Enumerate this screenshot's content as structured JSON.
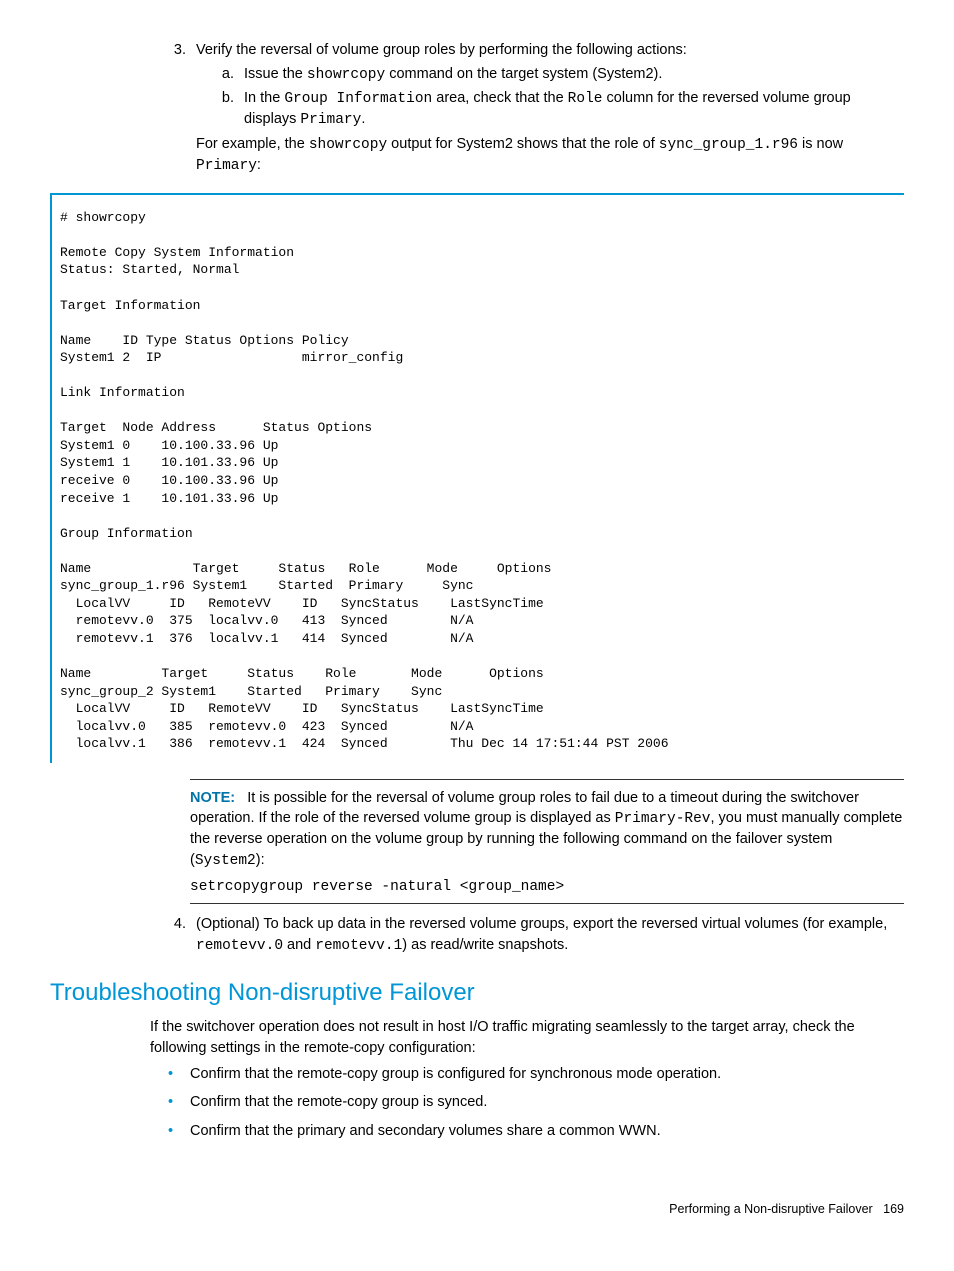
{
  "steps": {
    "s3": {
      "intro": "Verify the reversal of volume group roles by performing the following actions:",
      "a_pre": "Issue the ",
      "a_cmd": "showrcopy",
      "a_post": " command on the target system (System2).",
      "b_pre": "In the ",
      "b_code1": "Group Information",
      "b_mid1": " area, check that the ",
      "b_code2": "Role",
      "b_mid2": " column for the reversed volume group displays ",
      "b_code3": "Primary",
      "b_end": ".",
      "eg_pre": "For example, the ",
      "eg_c1": "showrcopy",
      "eg_mid": " output for System2 shows that the role of ",
      "eg_c2": "sync_group_1.r96",
      "eg_mid2": " is now ",
      "eg_c3": "Primary",
      "eg_end": ":"
    },
    "s4": {
      "pre": "(Optional) To back up data in the reversed volume groups, export the reversed virtual volumes (for example, ",
      "c1": "remotevv.0",
      "mid": " and ",
      "c2": "remotevv.1",
      "post": ") as read/write snapshots."
    }
  },
  "code": "# showrcopy\n\nRemote Copy System Information\nStatus: Started, Normal\n\nTarget Information\n\nName    ID Type Status Options Policy\nSystem1 2  IP                  mirror_config\n\nLink Information\n\nTarget  Node Address      Status Options\nSystem1 0    10.100.33.96 Up\nSystem1 1    10.101.33.96 Up\nreceive 0    10.100.33.96 Up\nreceive 1    10.101.33.96 Up\n\nGroup Information\n\nName             Target     Status   Role      Mode     Options\nsync_group_1.r96 System1    Started  Primary     Sync\n  LocalVV     ID   RemoteVV    ID   SyncStatus    LastSyncTime\n  remotevv.0  375  localvv.0   413  Synced        N/A\n  remotevv.1  376  localvv.1   414  Synced        N/A\n\nName         Target     Status    Role       Mode      Options\nsync_group_2 System1    Started   Primary    Sync\n  LocalVV     ID   RemoteVV    ID   SyncStatus    LastSyncTime\n  localvv.0   385  remotevv.0  423  Synced        N/A\n  localvv.1   386  remotevv.1  424  Synced        Thu Dec 14 17:51:44 PST 2006",
  "note": {
    "label": "NOTE:",
    "t1": "It is possible for the reversal of volume group roles to fail due to a timeout during the switchover operation. If the role of the reversed volume group is displayed as ",
    "c1": "Primary-Rev",
    "t2": ", you must manually complete the reverse operation on the volume group by running the following command on the failover system (",
    "c2": "System2",
    "t3": "):",
    "cmd": "setrcopygroup reverse -natural <group_name>"
  },
  "troubleshoot": {
    "heading": "Troubleshooting Non-disruptive Failover",
    "intro": "If the switchover operation does not result in host I/O traffic migrating seamlessly to the target array, check the following settings in the remote-copy configuration:",
    "b1": "Confirm that the remote-copy group is configured for synchronous mode operation.",
    "b2": "Confirm that the remote-copy group is synced.",
    "b3": "Confirm that the primary and secondary volumes share a common WWN."
  },
  "footer": {
    "title": "Performing a Non-disruptive Failover",
    "page": "169"
  }
}
